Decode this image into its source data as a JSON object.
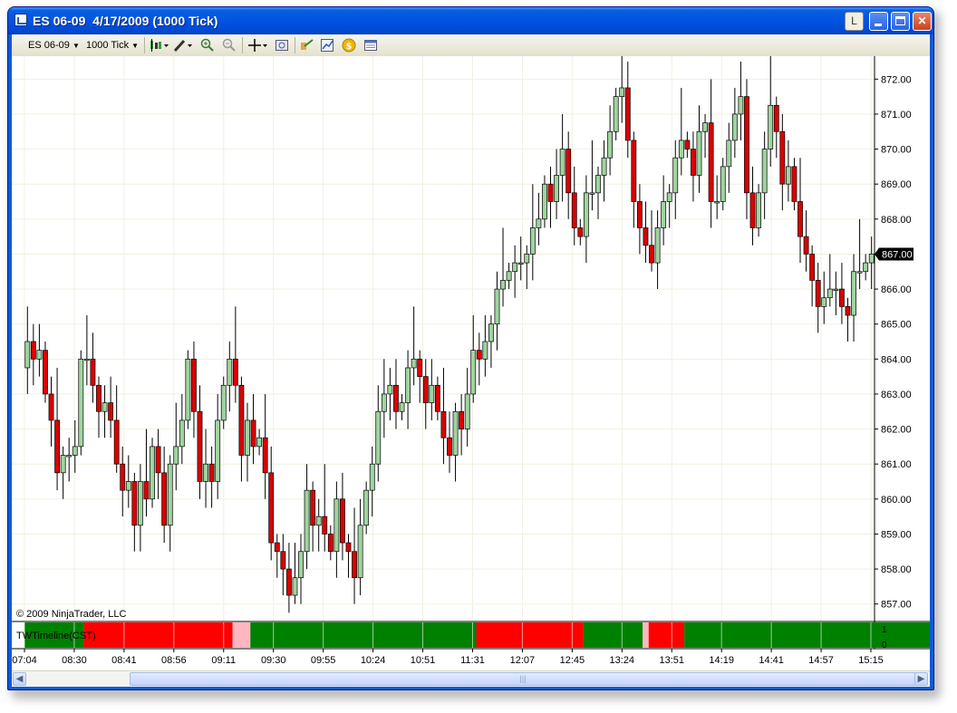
{
  "window": {
    "title": "ES 06-09  4/17/2009 (1000 Tick)",
    "btn_L": "L"
  },
  "toolbar": {
    "instrument": "ES 06-09",
    "interval": "1000 Tick",
    "icons": [
      "candlestick-style-icon",
      "drawing-pencil-icon",
      "zoom-in-icon",
      "zoom-out-icon",
      "crosshair-icon",
      "properties-icon",
      "indicators-icon",
      "strategies-icon",
      "money-icon",
      "data-box-icon"
    ]
  },
  "colors": {
    "up_fill": "#9fd49f",
    "down_fill": "#dc0000",
    "timeline_green": "#008000",
    "timeline_red": "#ff0000",
    "timeline_pink": "#ffb6c1",
    "price_marker": "#000000"
  },
  "chart_data": {
    "type": "candlestick",
    "copyright": "© 2009 NinjaTrader, LLC",
    "y_ticks": [
      "872.00",
      "871.00",
      "870.00",
      "869.00",
      "868.00",
      "867.00",
      "866.00",
      "865.00",
      "864.00",
      "863.00",
      "862.00",
      "861.00",
      "860.00",
      "859.00",
      "858.00",
      "857.00"
    ],
    "y_range": [
      856.5,
      872.5
    ],
    "last_price": "867.00",
    "x_ticks": [
      "07:04",
      "08:30",
      "08:41",
      "08:56",
      "09:11",
      "09:30",
      "09:55",
      "10:24",
      "10:51",
      "11:31",
      "12:07",
      "12:45",
      "13:24",
      "13:51",
      "14:19",
      "14:41",
      "14:57",
      "15:15"
    ],
    "closes": [
      864.5,
      864.0,
      864.25,
      863.0,
      862.25,
      860.75,
      861.25,
      861.25,
      861.5,
      864.0,
      864.0,
      863.25,
      862.5,
      862.75,
      862.25,
      861.0,
      860.25,
      860.5,
      859.25,
      860.5,
      860.0,
      861.5,
      860.75,
      859.25,
      861.0,
      861.5,
      862.25,
      864.0,
      862.5,
      860.5,
      861.0,
      860.5,
      862.25,
      863.25,
      864.0,
      863.25,
      861.25,
      862.25,
      861.5,
      861.75,
      860.75,
      858.75,
      858.5,
      858.0,
      857.25,
      857.75,
      858.5,
      860.25,
      859.25,
      859.5,
      859.0,
      858.5,
      860.0,
      858.75,
      858.5,
      857.75,
      859.25,
      860.25,
      861.0,
      862.5,
      863.0,
      863.25,
      862.5,
      862.75,
      863.75,
      864.0,
      863.5,
      862.75,
      863.25,
      862.5,
      861.75,
      861.25,
      862.5,
      862.0,
      863.0,
      864.25,
      864.0,
      864.5,
      865.0,
      866.0,
      866.25,
      866.5,
      866.75,
      866.75,
      867.0,
      867.75,
      868.0,
      869.0,
      868.5,
      869.25,
      870.0,
      868.75,
      867.75,
      867.5,
      868.75,
      868.75,
      869.25,
      869.75,
      870.5,
      871.5,
      871.75,
      870.25,
      868.5,
      867.75,
      867.25,
      866.75,
      867.75,
      868.5,
      868.75,
      869.75,
      870.25,
      870.0,
      869.25,
      870.5,
      870.75,
      868.5,
      868.5,
      869.5,
      870.25,
      871.0,
      871.5,
      868.75,
      867.75,
      868.75,
      870.0,
      871.25,
      870.5,
      869.0,
      869.5,
      868.5,
      867.5,
      867.0,
      866.25,
      865.5,
      865.75,
      866.0,
      866.0,
      865.5,
      865.25,
      866.5,
      866.5,
      866.75,
      867.0
    ],
    "timeline": {
      "label": "TWTimeline(CST)",
      "right_ticks": [
        "1",
        "0"
      ],
      "segments": [
        {
          "color": "green",
          "bars": 10
        },
        {
          "color": "red",
          "bars": 25
        },
        {
          "color": "pink",
          "bars": 3
        },
        {
          "color": "green",
          "bars": 38
        },
        {
          "color": "red",
          "bars": 18
        },
        {
          "color": "green",
          "bars": 10
        },
        {
          "color": "pink",
          "bars": 1
        },
        {
          "color": "red",
          "bars": 6
        },
        {
          "color": "green",
          "bars": 42
        }
      ]
    }
  }
}
